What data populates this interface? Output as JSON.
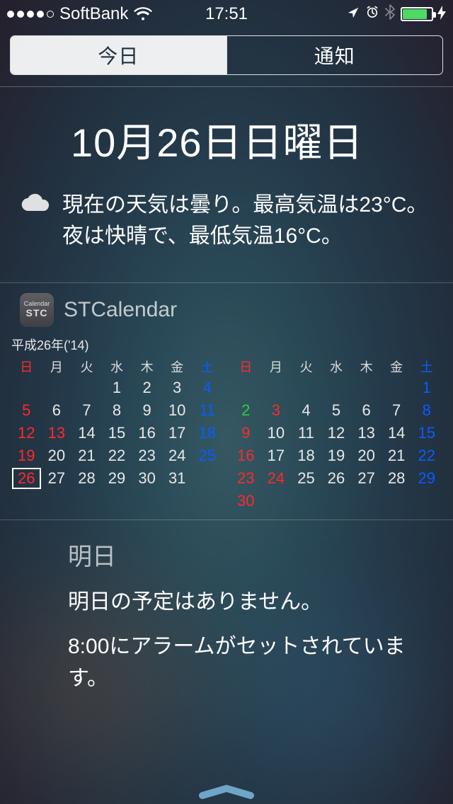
{
  "status_bar": {
    "carrier": "SoftBank",
    "signal_filled": 4,
    "signal_total": 5,
    "time": "17:51",
    "location_icon": "location-arrow-icon",
    "alarm_icon": "alarm-clock-icon",
    "bluetooth_icon": "bluetooth-icon",
    "battery_charging": true,
    "battery_color": "#4cd964"
  },
  "tabs": {
    "today": "今日",
    "notifications": "通知",
    "active": "today"
  },
  "today": {
    "date_heading": "10月26日日曜日",
    "weather_text": "現在の天気は曇り。最高気温は23°C。夜は快晴で、最低気温16°C。",
    "weather_icon": "cloud-icon"
  },
  "widget": {
    "app_name": "STCalendar",
    "app_icon_top": "Calendar",
    "app_icon_bottom": "STC",
    "era_label": "平成26年('14)",
    "weekday_labels": [
      "日",
      "月",
      "火",
      "水",
      "木",
      "金",
      "土"
    ],
    "month_left": {
      "days": [
        [
          null,
          null,
          null,
          1,
          2,
          3,
          4
        ],
        [
          5,
          6,
          7,
          8,
          9,
          10,
          11
        ],
        [
          12,
          13,
          14,
          15,
          16,
          17,
          18
        ],
        [
          19,
          20,
          21,
          22,
          23,
          24,
          25
        ],
        [
          26,
          27,
          28,
          29,
          30,
          31,
          null
        ]
      ],
      "holidays": [
        13
      ],
      "today": 26
    },
    "month_right": {
      "days": [
        [
          null,
          null,
          null,
          null,
          null,
          null,
          1
        ],
        [
          2,
          3,
          4,
          5,
          6,
          7,
          8
        ],
        [
          9,
          10,
          11,
          12,
          13,
          14,
          15
        ],
        [
          16,
          17,
          18,
          19,
          20,
          21,
          22
        ],
        [
          23,
          24,
          25,
          26,
          27,
          28,
          29
        ],
        [
          30,
          null,
          null,
          null,
          null,
          null,
          null
        ]
      ],
      "holidays": [
        3,
        23,
        24
      ],
      "green_days": [
        2
      ]
    }
  },
  "tomorrow": {
    "title": "明日",
    "no_events": "明日の予定はありません。",
    "alarm_text": "8:00にアラームがセットされています。"
  }
}
